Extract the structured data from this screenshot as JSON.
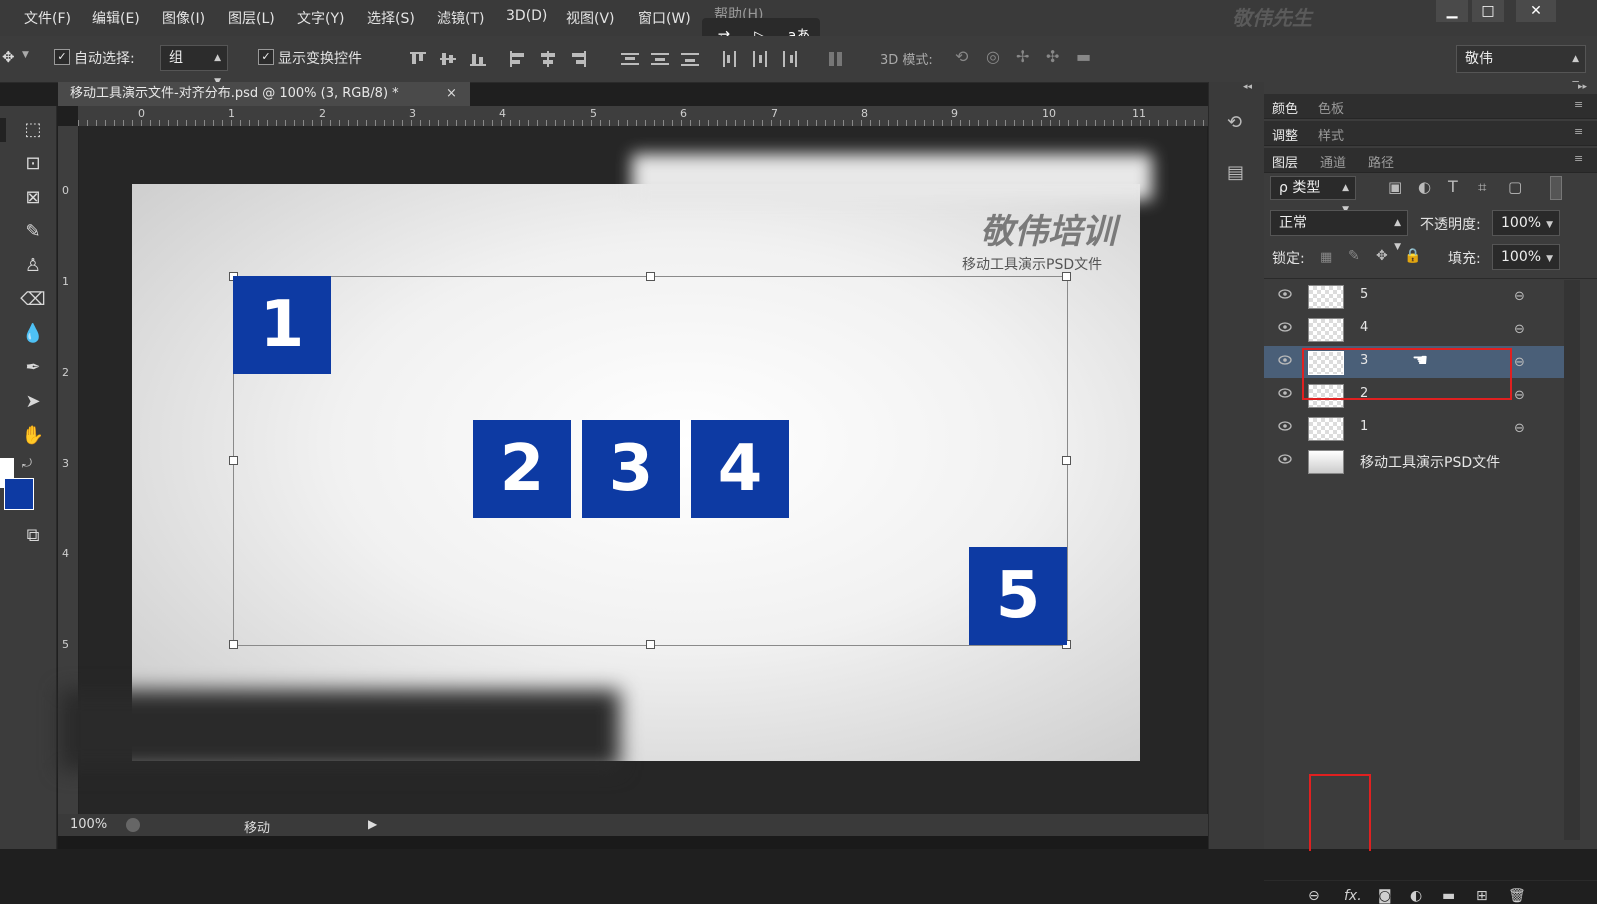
{
  "menu": {
    "items": [
      "文件(F)",
      "编辑(E)",
      "图像(I)",
      "图层(L)",
      "文字(Y)",
      "选择(S)",
      "滤镜(T)",
      "3D(D)",
      "视图(V)",
      "窗口(W)",
      "帮助(H)"
    ],
    "watermark": "敬伟先生",
    "window_buttons": [
      "▁",
      "□",
      "✕"
    ]
  },
  "floating_toolbar": {
    "translate_icon_text": "aあ"
  },
  "options": {
    "auto_select_label": "自动选择:",
    "auto_select_value": "组",
    "show_transform_label": "显示变换控件",
    "mode_3d_label": "3D 模式:",
    "workspace_value": "敬伟"
  },
  "document": {
    "tab_title": "移动工具演示文件-对齐分布.psd @ 100% (3, RGB/8) *",
    "tab_close": "×",
    "ruler_h": [
      "0",
      "1",
      "2",
      "3",
      "4",
      "5",
      "6",
      "7",
      "8",
      "9",
      "10",
      "11"
    ],
    "ruler_v": [
      "0",
      "1",
      "2",
      "3",
      "4",
      "5"
    ],
    "canvas_brand": "敬伟培训",
    "canvas_caption": "移动工具演示PSD文件",
    "boxes": [
      "1",
      "2",
      "3",
      "4",
      "5"
    ],
    "zoom": "100%",
    "status_text": "移动"
  },
  "panels": {
    "group1_tabs": [
      "颜色",
      "色板"
    ],
    "group2_tabs": [
      "调整",
      "样式"
    ],
    "group3_tabs": [
      "图层",
      "通道",
      "路径"
    ],
    "filter_label": "ρ 类型",
    "blend_mode": "正常",
    "opacity_label": "不透明度:",
    "opacity_value": "100%",
    "lock_label": "锁定:",
    "fill_label": "填充:",
    "fill_value": "100%",
    "layers": [
      {
        "name": "5",
        "selected": false
      },
      {
        "name": "4",
        "selected": false
      },
      {
        "name": "3",
        "selected": true
      },
      {
        "name": "2",
        "selected": false
      },
      {
        "name": "1",
        "selected": false
      },
      {
        "name": "移动工具演示PSD文件",
        "selected": false
      }
    ]
  },
  "colors": {
    "accent_blue": "#0d3aa3",
    "selection_row": "#4a5f78",
    "highlight_red": "#e02020"
  }
}
